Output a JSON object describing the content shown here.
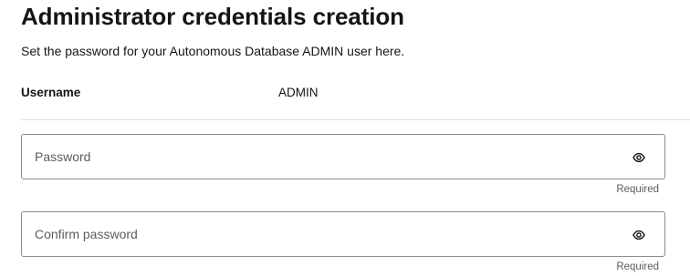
{
  "header": {
    "title": "Administrator credentials creation",
    "description": "Set the password for your Autonomous Database ADMIN user here."
  },
  "username": {
    "label": "Username",
    "value": "ADMIN"
  },
  "password_field": {
    "placeholder": "Password",
    "value": "",
    "helper": "Required",
    "icon": "eye-icon"
  },
  "confirm_password_field": {
    "placeholder": "Confirm password",
    "value": "",
    "helper": "Required",
    "icon": "eye-icon"
  },
  "colors": {
    "text": "#161513",
    "muted": "#5f5c58",
    "border": "#8f8c87",
    "divider": "#e4e1dd"
  }
}
